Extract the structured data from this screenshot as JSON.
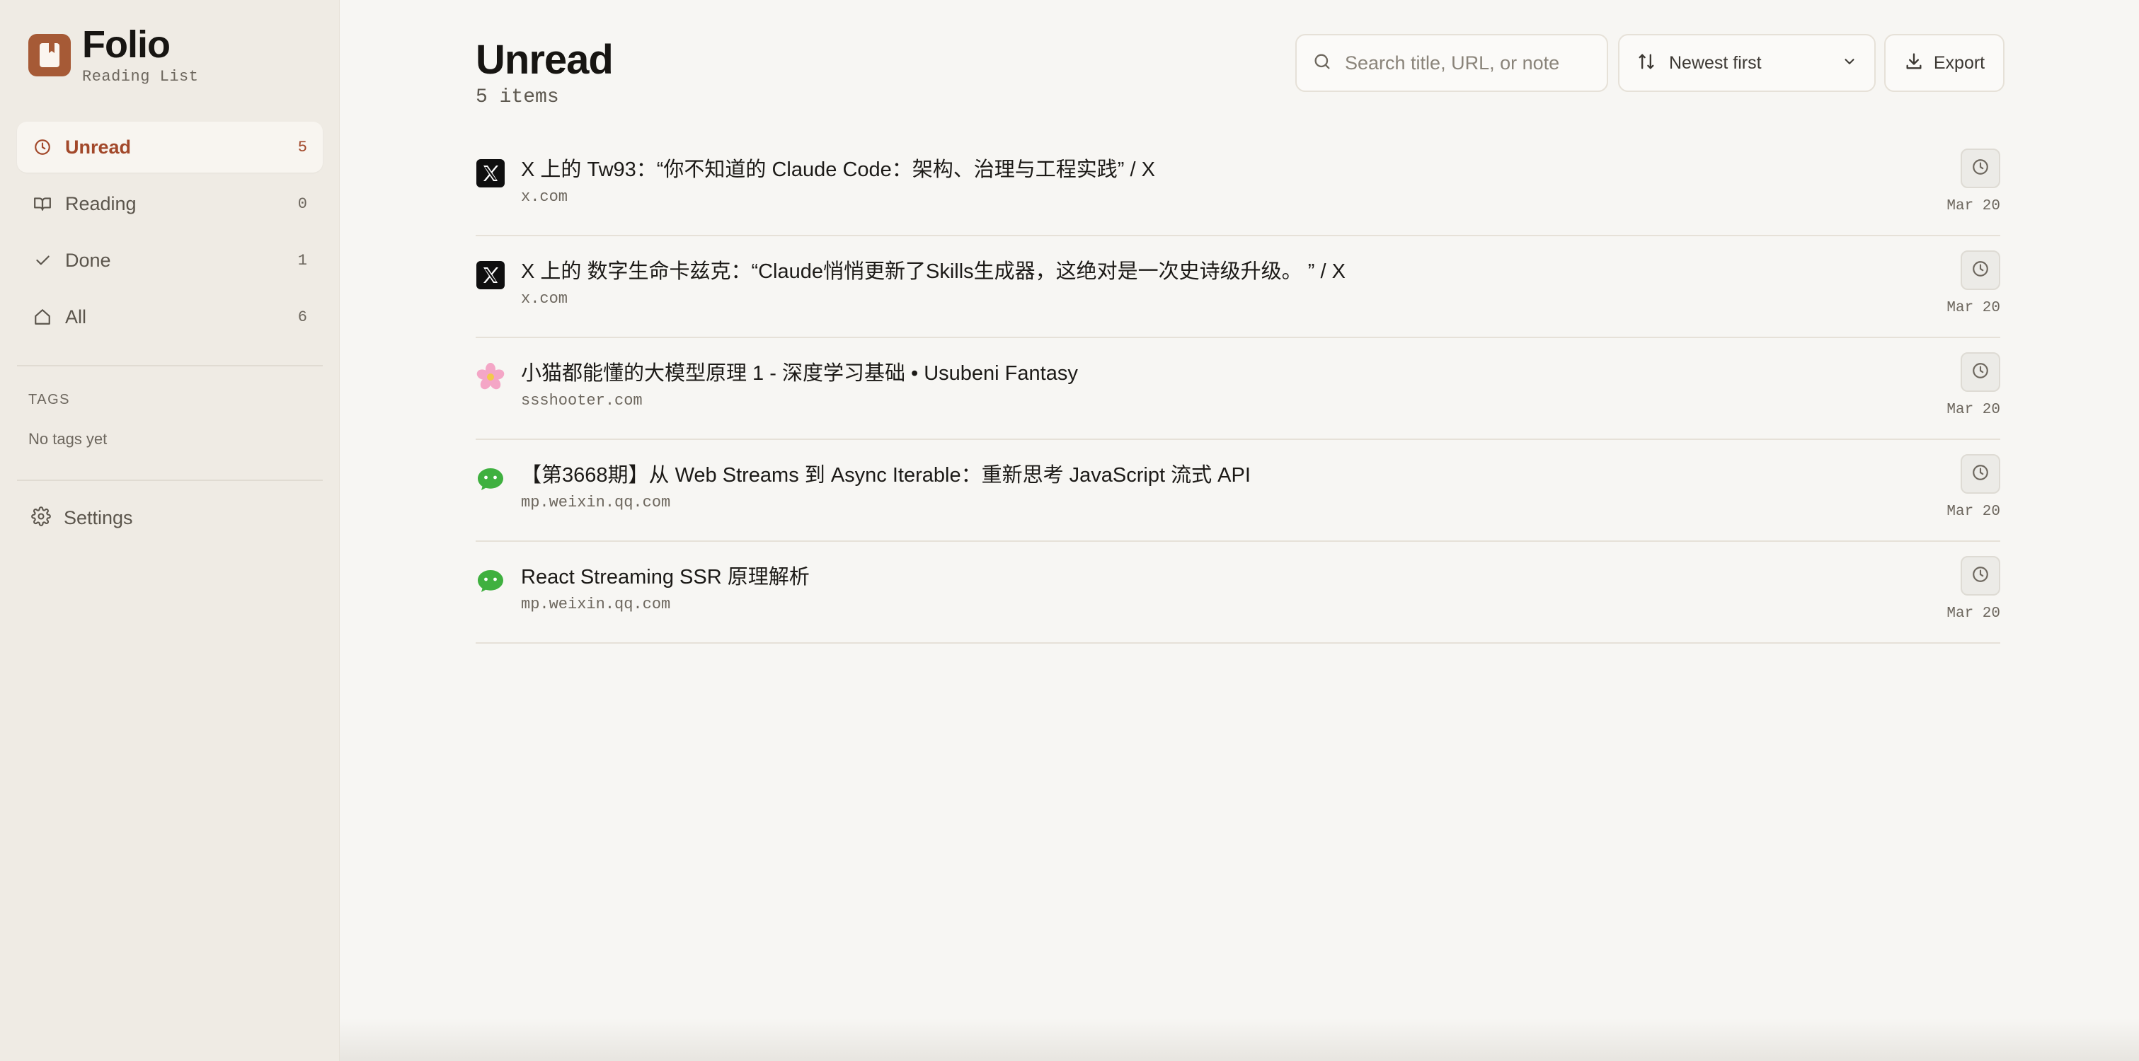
{
  "brand": {
    "name": "Folio",
    "subtitle": "Reading List",
    "accent": "#a65a36"
  },
  "sidebar": {
    "nav": [
      {
        "id": "unread",
        "label": "Unread",
        "count": "5",
        "icon": "clock-icon",
        "active": true
      },
      {
        "id": "reading",
        "label": "Reading",
        "count": "0",
        "icon": "book-open-icon",
        "active": false
      },
      {
        "id": "done",
        "label": "Done",
        "count": "1",
        "icon": "check-icon",
        "active": false
      },
      {
        "id": "all",
        "label": "All",
        "count": "6",
        "icon": "home-icon",
        "active": false
      }
    ],
    "tags_title": "TAGS",
    "tags_empty": "No tags yet",
    "settings_label": "Settings"
  },
  "main": {
    "title": "Unread",
    "count_text": "5 items",
    "search": {
      "placeholder": "Search title, URL, or note",
      "value": ""
    },
    "sort": {
      "label": "Newest first"
    },
    "export_label": "Export",
    "items": [
      {
        "icon": "x-logo-icon",
        "title": "X 上的 Tw93：“你不知道的 Claude Code：架构、治理与工程实践” / X",
        "domain": "x.com",
        "date": "Mar 20"
      },
      {
        "icon": "x-logo-icon",
        "title": "X 上的 数字生命卡兹克：“Claude悄悄更新了Skills生成器，这绝对是一次史诗级升级。 ” / X",
        "domain": "x.com",
        "date": "Mar 20"
      },
      {
        "icon": "sakura-icon",
        "title": "小猫都能懂的大模型原理 1 - 深度学习基础 • Usubeni Fantasy",
        "domain": "ssshooter.com",
        "date": "Mar 20"
      },
      {
        "icon": "wechat-icon",
        "title": "【第3668期】从 Web Streams 到 Async Iterable：重新思考 JavaScript 流式 API",
        "domain": "mp.weixin.qq.com",
        "date": "Mar 20"
      },
      {
        "icon": "wechat-icon",
        "title": "React Streaming SSR 原理解析",
        "domain": "mp.weixin.qq.com",
        "date": "Mar 20"
      }
    ]
  }
}
